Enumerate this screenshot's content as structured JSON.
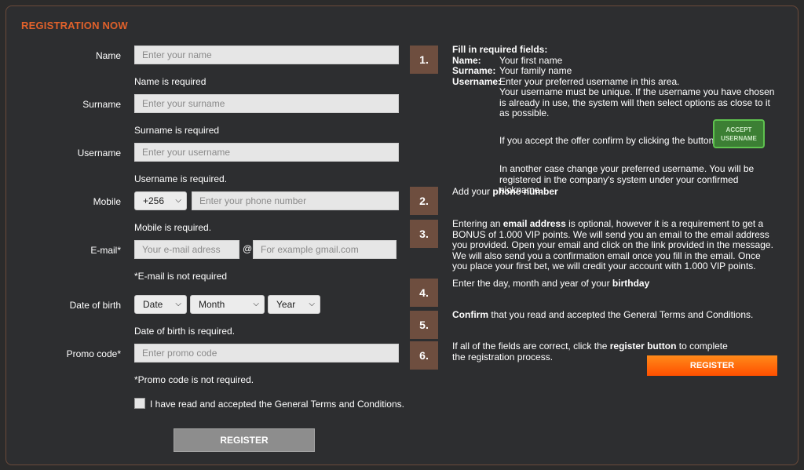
{
  "form": {
    "title": "REGISTRATION NOW",
    "name": {
      "label": "Name",
      "placeholder": "Enter your name",
      "hint": "Name is required"
    },
    "surname": {
      "label": "Surname",
      "placeholder": "Enter your surname",
      "hint": "Surname is required"
    },
    "username": {
      "label": "Username",
      "placeholder": "Enter your username",
      "hint": "Username is required."
    },
    "mobile": {
      "label": "Mobile",
      "code": "+256",
      "placeholder": "Enter your phone number",
      "hint": "Mobile is required."
    },
    "email": {
      "label": "E-mail*",
      "placeholder_user": "Your e-mail adress",
      "at": "@",
      "placeholder_domain": "For example gmail.com",
      "hint": "*E-mail is not required"
    },
    "dob": {
      "label": "Date of birth",
      "day": "Date",
      "month": "Month",
      "year": "Year",
      "hint": "Date of birth is required."
    },
    "promo": {
      "label": "Promo code*",
      "placeholder": "Enter promo code",
      "hint": "*Promo code is not required."
    },
    "terms": "I have read and accepted the General Terms and Conditions.",
    "register": "REGISTER"
  },
  "steps": [
    "1.",
    "2.",
    "3.",
    "4.",
    "5.",
    "6."
  ],
  "info": {
    "s1": {
      "heading": "Fill in required fields:",
      "name_k": "Name:",
      "name_v": "Your first name",
      "surname_k": "Surname:",
      "surname_v": "Your family name",
      "username_k": "Username:",
      "username_v": "Enter your preferred username in this area.",
      "unique": "Your username must be unique. If the username you have chosen is already in use, the system will then select options as close to it as possible.",
      "accept_text": "If you accept the offer confirm by clicking the button",
      "accept_btn": "ACCEPT USERNAME",
      "other": "In another case change your preferred username. You will be registered in the company's system under your confirmed nickname."
    },
    "s2": {
      "pre": "Add your ",
      "bold": "phone number"
    },
    "s3": {
      "pre": "Entering an ",
      "bold": "email address",
      "post": " is optional, however it is a requirement to get a BONUS of 1.000 VIP points. We will send you an email to the email address you provided. Open your email and click on the link provided in the message. We will also send you a confirmation email once you fill in the email. Once you place your first bet, we will credit your account with 1.000 VIP points."
    },
    "s4": {
      "pre": "Enter the day, month and year of your ",
      "bold": "birthday"
    },
    "s5": {
      "bold": "Confirm",
      "post": " that you read and accepted the General Terms and Conditions."
    },
    "s6": {
      "pre": "If all of the fields are correct, click the ",
      "bold": "register button",
      "post": " to complete the registration process."
    },
    "register": "REGISTER"
  }
}
